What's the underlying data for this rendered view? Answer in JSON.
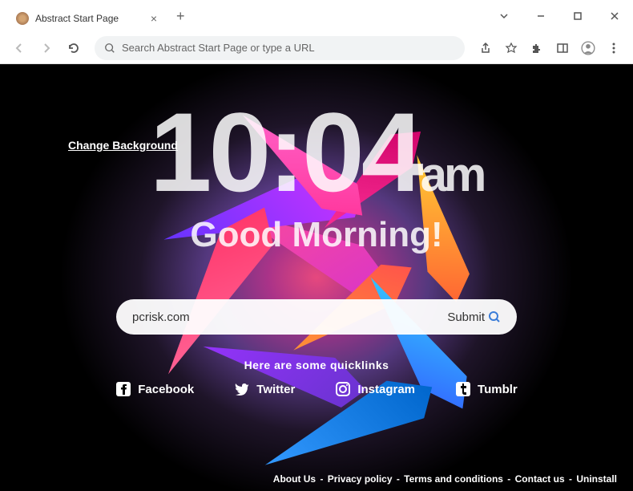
{
  "window": {
    "tab_title": "Abstract Start Page"
  },
  "toolbar": {
    "omnibox_placeholder": "Search Abstract Start Page or type a URL"
  },
  "page": {
    "change_background_label": "Change Background",
    "clock_time": "10:04",
    "clock_ampm": "am",
    "greeting": "Good Morning!",
    "search_value": "pcrisk.com",
    "submit_label": "Submit",
    "quicklinks_header": "Here are some quicklinks",
    "quicklinks": [
      {
        "label": "Facebook"
      },
      {
        "label": "Twitter"
      },
      {
        "label": "Instagram"
      },
      {
        "label": "Tumblr"
      }
    ],
    "footer": {
      "about": "About Us",
      "privacy": "Privacy policy",
      "terms": "Terms and conditions",
      "contact": "Contact us",
      "uninstall": "Uninstall",
      "separator": " - "
    }
  }
}
